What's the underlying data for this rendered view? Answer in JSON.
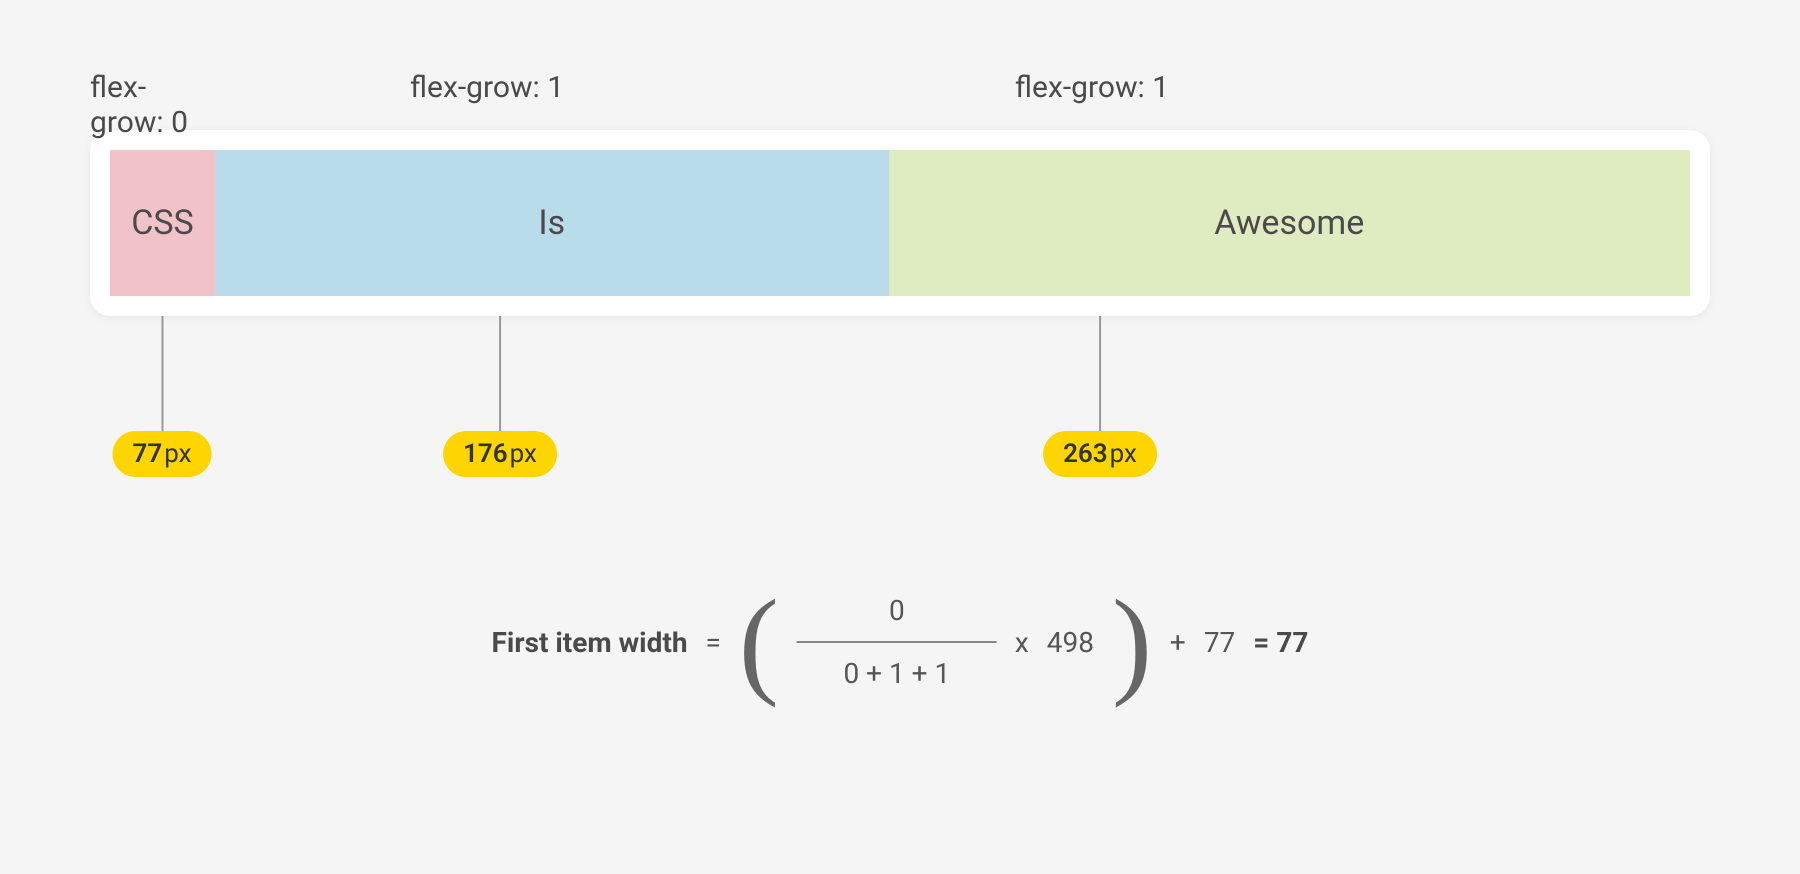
{
  "labels": {
    "item1": "flex-grow: 0",
    "item2": "flex-grow: 1",
    "item3": "flex-grow: 1"
  },
  "boxes": {
    "css": "CSS",
    "is": "Is",
    "awesome": "Awesome"
  },
  "measurements": {
    "m1": {
      "value": "77",
      "unit": "px"
    },
    "m2": {
      "value": "176",
      "unit": "px"
    },
    "m3": {
      "value": "263",
      "unit": "px"
    }
  },
  "formula": {
    "label": "First item width",
    "equals1": "=",
    "numerator": "0",
    "denominator": "0 + 1 + 1",
    "times": "x",
    "remaining": "498",
    "plus": "+",
    "basis": "77",
    "equals2": "= 77"
  }
}
